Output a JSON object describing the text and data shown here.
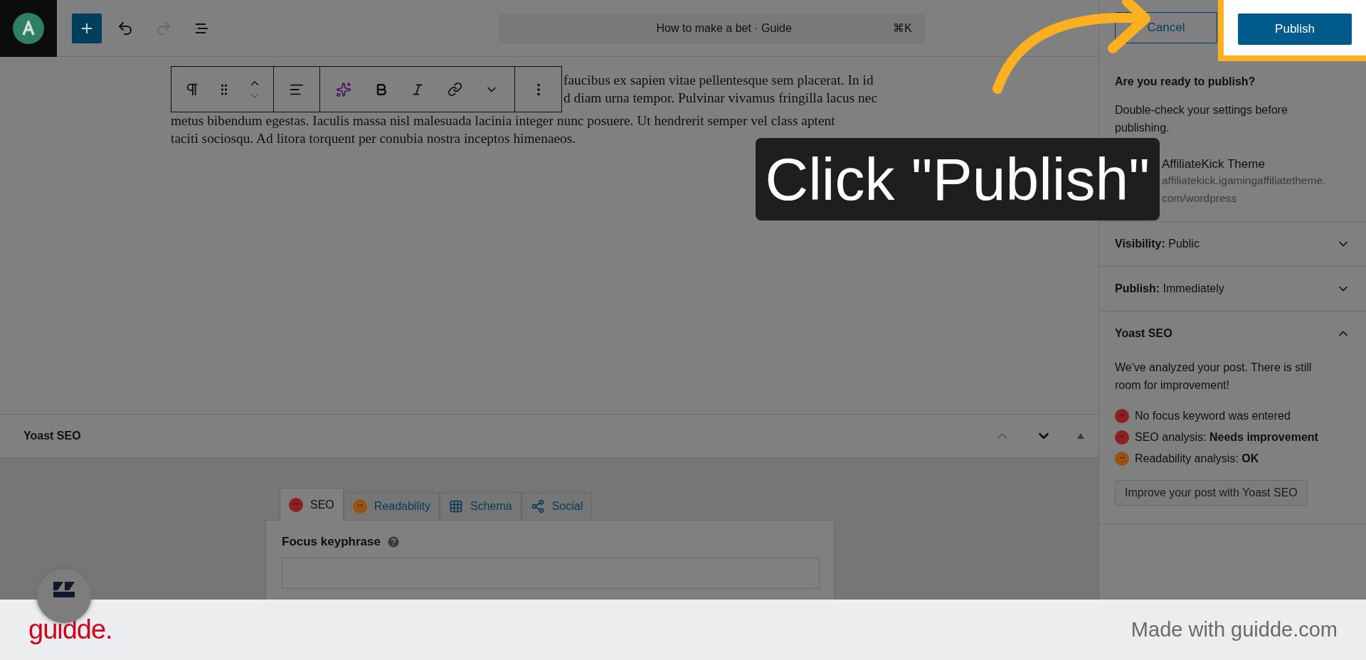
{
  "top_bar": {
    "document_title": "How to make a bet · Guide",
    "shortcut": "⌘K",
    "redo_disabled": true
  },
  "editor": {
    "partial_lines": [
      "faucibus ex sapien vitae pellentesque sem placerat. In id",
      "d diam urna tempor. Pulvinar vivamus fringilla lacus nec"
    ],
    "full_lines": [
      "metus bibendum egestas. Iaculis massa nisl malesuada lacinia integer nunc posuere. Ut hendrerit semper vel class aptent",
      "taciti sociosqu. Ad litora torquent per conubia nostra inceptos himenaeos."
    ]
  },
  "annotation": {
    "caption": "Click \"Publish\""
  },
  "sidebar": {
    "cancel": "Cancel",
    "publish": "Publish",
    "heading": "Are you ready to publish?",
    "description": "Double-check your settings before publishing.",
    "site": {
      "name": "AffiliateKick Theme",
      "url": "affiliatekick.igamingaffiliatetheme.com/wordpress"
    },
    "panels": [
      {
        "label": "Visibility:",
        "value": "Public",
        "expanded": false
      },
      {
        "label": "Publish:",
        "value": "Immediately",
        "expanded": false
      }
    ],
    "yoast": {
      "title": "Yoast SEO",
      "expanded": true,
      "summary": "We've analyzed your post. There is still room for improvement!",
      "checks": [
        {
          "text": "No focus keyword was entered",
          "color": "#8c1f1f"
        },
        {
          "text": "SEO analysis: **Needs improvement**",
          "color": "#8c1f1f"
        },
        {
          "text": "Readability analysis: **OK**",
          "color": "#9a5214"
        }
      ],
      "button": "Improve your post with Yoast SEO"
    }
  },
  "metabox": {
    "title": "Yoast SEO",
    "tabs": [
      {
        "label": "SEO",
        "kind": "score",
        "color": "#8c1f1f",
        "selected": true
      },
      {
        "label": "Readability",
        "kind": "score",
        "color": "#9a5214",
        "selected": false
      },
      {
        "label": "Schema",
        "kind": "schema",
        "selected": false
      },
      {
        "label": "Social",
        "kind": "social",
        "selected": false
      }
    ],
    "focus_label": "Focus keyphrase"
  },
  "footer": {
    "brand": "guidde.",
    "credit": "Made with guidde.com"
  }
}
